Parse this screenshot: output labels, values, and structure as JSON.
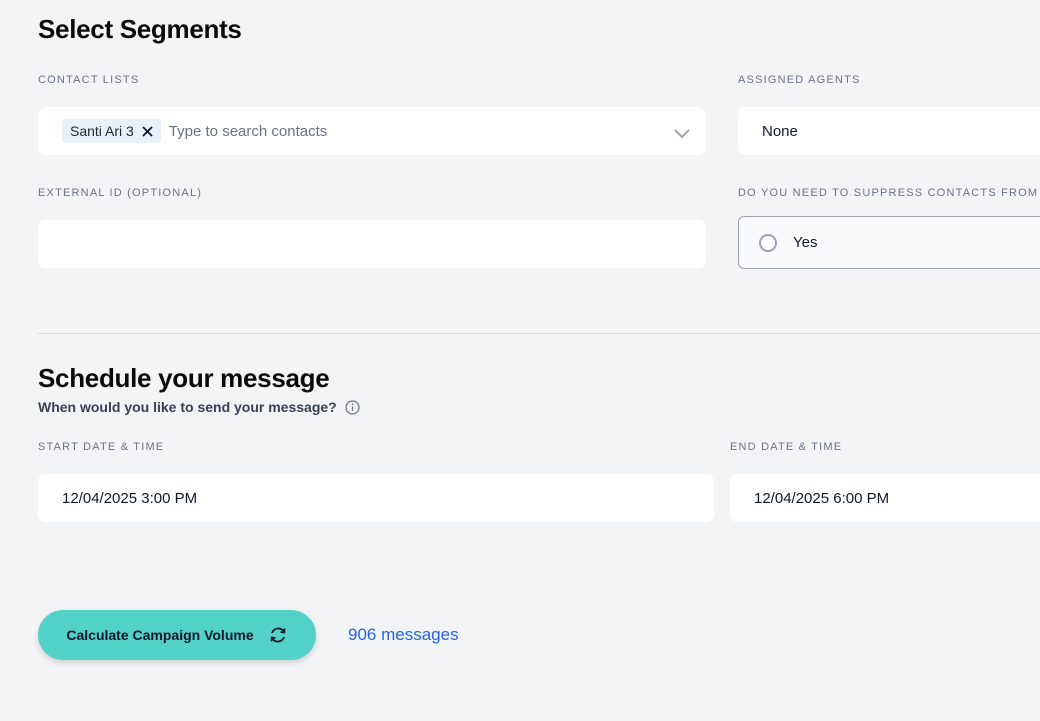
{
  "segments": {
    "title": "Select Segments",
    "contact_lists": {
      "label": "CONTACT LISTS",
      "chips": [
        "Santi Ari 3"
      ],
      "placeholder": "Type to search contacts"
    },
    "assigned_agents": {
      "label": "ASSIGNED AGENTS",
      "value": "None"
    },
    "external_id": {
      "label": "EXTERNAL ID (OPTIONAL)",
      "value": ""
    },
    "suppress": {
      "label": "DO YOU NEED TO SUPPRESS CONTACTS FROM A L",
      "option_label": "Yes"
    }
  },
  "schedule": {
    "title": "Schedule your message",
    "subtitle": "When would you like to send your message?",
    "start": {
      "label": "START DATE & TIME",
      "value": "12/04/2025 3:00 PM"
    },
    "end": {
      "label": "END DATE & TIME",
      "value": "12/04/2025 6:00 PM"
    }
  },
  "actions": {
    "calculate_label": "Calculate Campaign Volume",
    "volume_text": "906 messages"
  },
  "colors": {
    "accent": "#52d1c7",
    "link": "#2563eb",
    "background": "#f3f4f6"
  },
  "icons": {
    "chip_remove": "close-icon",
    "dropdown": "chevron-down-icon",
    "info": "info-icon",
    "refresh": "refresh-icon"
  }
}
